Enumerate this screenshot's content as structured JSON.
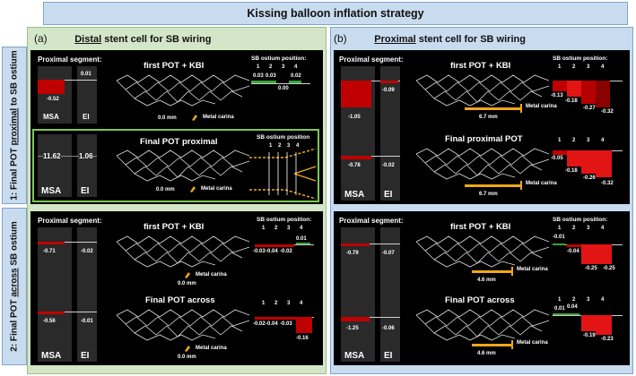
{
  "title": "Kissing balloon inflation strategy",
  "row_labels": {
    "row1": {
      "prefix": "1: Final POT ",
      "emph": "proximal",
      "suffix": " to SB ostium"
    },
    "row2": {
      "prefix": "2: Final POT ",
      "emph": "across",
      "suffix": " SB ostium"
    }
  },
  "columns": {
    "a": {
      "letter": "(a)",
      "emph": "Distal",
      "rest": " stent cell for SB wiring"
    },
    "b": {
      "letter": "(b)",
      "emph": "Proximal",
      "rest": " stent cell for SB wiring"
    }
  },
  "common": {
    "proximal_segment": "Proximal segment:",
    "sb_ostium_position": "SB ostium position:",
    "sb_ostium_position_short": "SB ostium position",
    "metal_carina": "Metal carina",
    "msa": "MSA",
    "ei": "EI",
    "positions": [
      "1",
      "2",
      "3",
      "4"
    ]
  },
  "panels": {
    "a1": {
      "top_title": "first POT + KBI",
      "top_msa": "-0.52",
      "top_ei": "0.01",
      "top_distance": "0.0 mm",
      "top_ostium_values": [
        "0.03",
        "0.03",
        "0.00",
        "0.02"
      ],
      "bottom_title": "Final POT proximal",
      "bottom_msa": "11.62",
      "bottom_ei": "1.06",
      "bottom_distance": "0.0 mm"
    },
    "a2": {
      "top_title": "first POT + KBI",
      "top_msa": "-0.71",
      "top_ei": "-0.02",
      "top_distance": "0.0 mm",
      "top_ostium_values": [
        "-0.03",
        "-0.04",
        "-0.02",
        "0.01"
      ],
      "bottom_title": "Final POT across",
      "bottom_msa": "-0.56",
      "bottom_ei": "-0.01",
      "bottom_distance": "0.0 mm",
      "bottom_ostium_values": [
        "-0.02",
        "-0.04",
        "-0.03",
        "-0.16"
      ]
    },
    "b1": {
      "top_title": "first POT + KBI",
      "top_msa": "-1.05",
      "top_ei": "-0.09",
      "top_distance": "6.7 mm",
      "top_ostium_values": [
        "-0.13",
        "-0.18",
        "-0.27",
        "-0.32"
      ],
      "bottom_title": "Final proximal POT",
      "bottom_msa": "-0.78",
      "bottom_ei": "-0.02",
      "bottom_distance": "6.7 mm",
      "bottom_ostium_values": [
        "-0.05",
        "-0.18",
        "-0.26",
        "-0.32"
      ]
    },
    "b2": {
      "top_title": "first POT + KBI",
      "top_msa": "-0.79",
      "top_ei": "-0.07",
      "top_distance": "4.6 mm",
      "top_ostium_values": [
        "-0.01",
        "-0.04",
        "-0.25",
        "-0.25"
      ],
      "bottom_title": "Final POT across",
      "bottom_msa": "-1.25",
      "bottom_ei": "-0.06",
      "bottom_distance": "4.6 mm",
      "bottom_ostium_values": [
        "0.01",
        "0.04",
        "-0.19",
        "-0.23"
      ]
    }
  },
  "colors": {
    "red": "#c00000",
    "green": "#3aa53a",
    "yellow": "#f0a818",
    "highlight_border": "#7dc850"
  }
}
